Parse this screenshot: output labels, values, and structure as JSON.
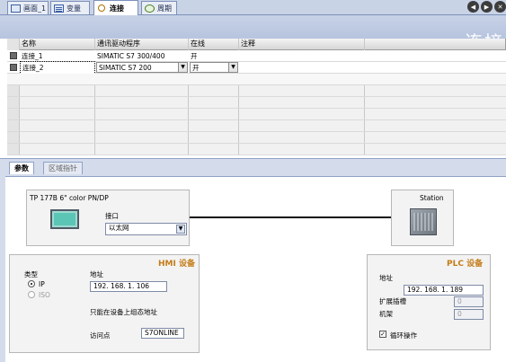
{
  "tabs": [
    {
      "label": "画面_1",
      "icon": "screen-icon"
    },
    {
      "label": "变量",
      "icon": "list-icon"
    },
    {
      "label": "连接",
      "icon": "connection-icon",
      "active": true
    },
    {
      "label": "周期",
      "icon": "cycle-icon"
    }
  ],
  "nav": {
    "prev": "◀",
    "next": "▶",
    "close": "✕"
  },
  "page_title": "连接",
  "grid": {
    "columns": [
      "名称",
      "通讯驱动程序",
      "在线",
      "注释"
    ],
    "rows": [
      {
        "name": "连接_1",
        "driver": "SIMATIC S7 300/400",
        "online": "开",
        "comment": ""
      },
      {
        "name": "连接_2",
        "driver": "SIMATIC S7 200",
        "online": "开",
        "comment": ""
      }
    ]
  },
  "lower_tabs": [
    "参数",
    "区域指针"
  ],
  "hmi_device": {
    "model": "TP 177B 6\" color PN/DP",
    "interface_label": "接口",
    "interface_value": "以太网",
    "section_title": "HMI 设备",
    "type_label": "类型",
    "type_options": [
      "IP",
      "ISO"
    ],
    "address_label": "地址",
    "address_value": "192. 168.  1. 106",
    "note": "只能在设备上组态地址",
    "access_point_label": "访问点",
    "access_point_value": "S7ONLINE"
  },
  "plc_device": {
    "station_label": "Station",
    "section_title": "PLC 设备",
    "address_label": "地址",
    "address_value": "192. 168.  1. 189",
    "slot_label": "扩展插槽",
    "slot_value": "0",
    "rack_label": "机架",
    "rack_value": "0",
    "cyclic_label": "循环操作",
    "cyclic_checked": true
  },
  "colors": {
    "section_title": "#c47b16",
    "titlebar": "#c7d2e7",
    "panel": "#d4dcec"
  }
}
